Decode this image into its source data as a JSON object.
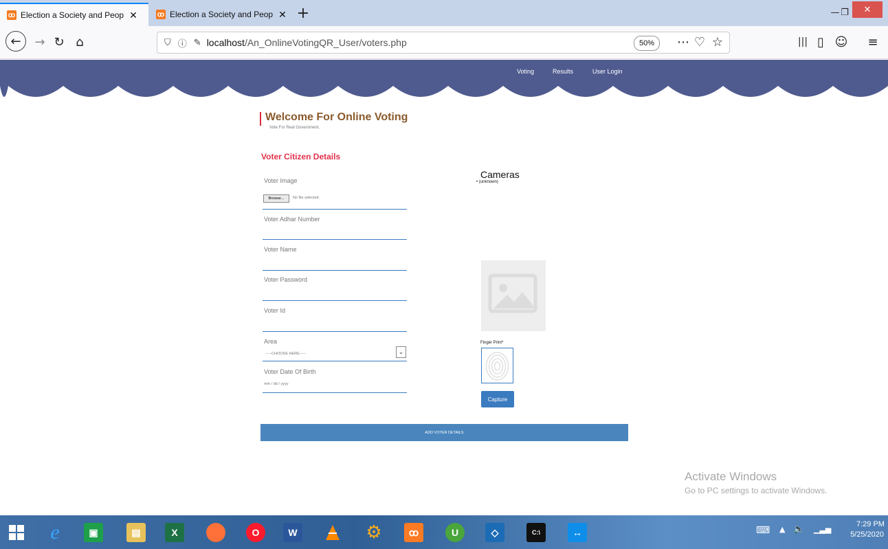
{
  "browser": {
    "tabs": [
      {
        "title": "Election a Society and People C",
        "favicon": "xampp-icon",
        "active": true
      },
      {
        "title": "Election a Society and People C",
        "favicon": "xampp-icon",
        "active": false
      }
    ],
    "url_host": "localhost",
    "url_path": "/An_OnlineVotingQR_User/voters.php",
    "zoom": "50%"
  },
  "site": {
    "menu": [
      "Voting",
      "Results",
      "User Login"
    ],
    "header_color": "#4f5b8f"
  },
  "page": {
    "welcome_title": "Welcome For Online Voting",
    "welcome_subtitle": "Vote For Real Government.",
    "section_title": "Voter Citizen Details",
    "accent_color": "#e2304a"
  },
  "form": {
    "voter_image_label": "Voter Image",
    "browse_label": "Browse...",
    "no_file_text": "No file selected.",
    "adhar_label": "Voter Adhar Number",
    "name_label": "Voter Name",
    "password_label": "Voter Password",
    "voter_id_label": "Voter Id",
    "area_label": "Area",
    "area_selected": "-----CHOOSE HERE-----",
    "dob_label": "Voter Date Of Birth",
    "dob_placeholder": "mm / dd / yyyy",
    "submit_label": "ADD VOTER DETAILS"
  },
  "camera": {
    "title": "Cameras",
    "items": [
      "(unknown)"
    ]
  },
  "fingerprint": {
    "label": "Finger Print*",
    "capture_label": "Capture"
  },
  "watermark": {
    "title": "Activate Windows",
    "subtitle": "Go to PC settings to activate Windows."
  },
  "taskbar": {
    "apps": [
      "windows-start-icon",
      "internet-explorer-icon",
      "store-icon",
      "file-explorer-icon",
      "excel-icon",
      "firefox-icon",
      "opera-icon",
      "word-icon",
      "vlc-icon",
      "settings-gear-icon",
      "xampp-icon",
      "utorrent-icon",
      "virtualbox-icon",
      "command-prompt-icon",
      "teamviewer-icon"
    ],
    "time": "7:29 PM",
    "date": "5/25/2020"
  }
}
